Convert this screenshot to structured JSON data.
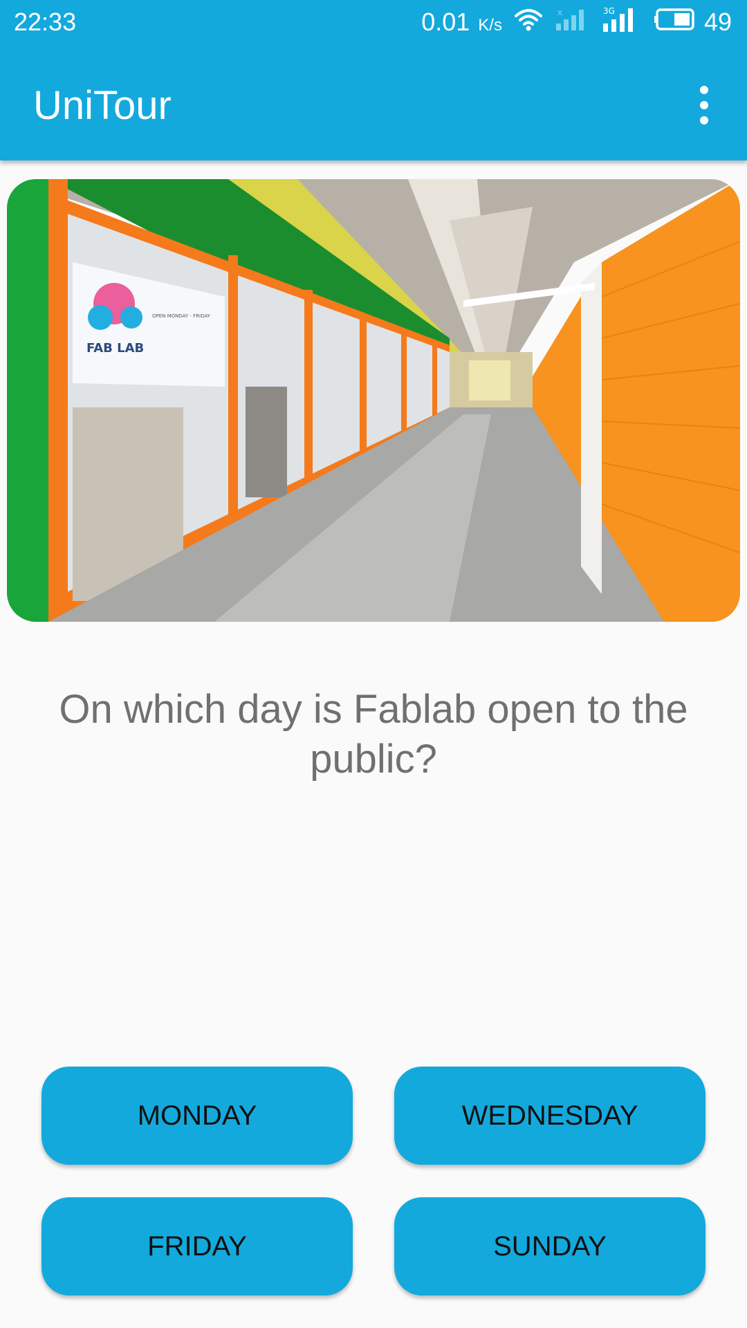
{
  "status_bar": {
    "time": "22:33",
    "net_speed": "0.01",
    "net_speed_unit": "K/s",
    "network_label": "3G",
    "battery": "49"
  },
  "app_bar": {
    "title": "UniTour",
    "overflow_icon": "more-vert-icon"
  },
  "hero": {
    "sign_text": "FAB LAB",
    "sign_hours": "OPEN MONDAY - FRIDAY"
  },
  "question": "On which day is Fablab open to the public?",
  "answers": [
    "MONDAY",
    "WEDNESDAY",
    "FRIDAY",
    "SUNDAY"
  ],
  "colors": {
    "primary": "#13a9dd",
    "question_text": "#707070",
    "button_text": "#111111",
    "background": "#fafafa"
  }
}
